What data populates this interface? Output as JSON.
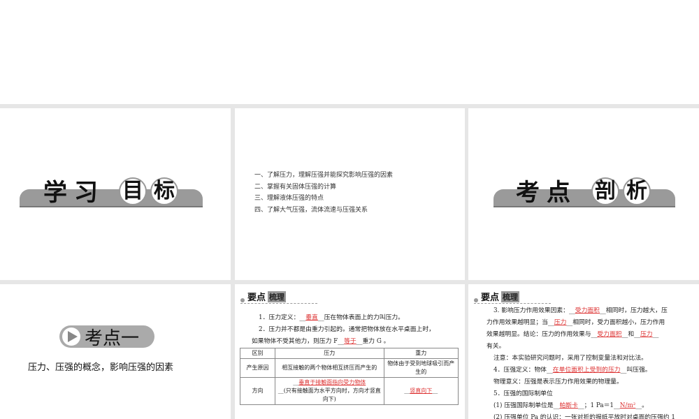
{
  "slide1": {
    "banner": [
      "学",
      "习",
      "目",
      "标"
    ]
  },
  "slide2": {
    "goals": [
      "一、了解压力，理解压强并能探究影响压强的因素",
      "二、掌握有关固体压强的计算",
      "三、理解液体压强的特点",
      "四、了解大气压强，流体流速与压强关系"
    ]
  },
  "slide3": {
    "banner": [
      "考",
      "点",
      "剖",
      "析"
    ]
  },
  "slide4": {
    "badge": "考点一",
    "subtitle": "压力、压强的概念，影响压强的因素"
  },
  "header": {
    "t1": "要点",
    "t2": "梳理"
  },
  "slide5": {
    "p1a": "1．压力定义：__",
    "p1b": "垂直",
    "p1c": "__压在物体表面上的力叫压力。",
    "p2a": "2．压力并不都是由重力引起的。通常把物体放在水平桌面上时，",
    "p2b": "如果物体不受其他力，则压力 F__",
    "p2c": "等于",
    "p2d": "__重力 G 。",
    "table": {
      "headers": [
        "区别",
        "压力",
        "重力"
      ],
      "row1": [
        "产生原因",
        "相互接触的两个物体相互挤压而产生的",
        "物体由于受到地球吸引而产生的"
      ],
      "row2_label": "方向",
      "row2_p_red": "垂直于接触面指向受力物体",
      "row2_p_rest": "__(只有接触面为水平方向时，方向才竖直向下)",
      "row2_g": "竖直向下"
    }
  },
  "slide6": {
    "l1a": "3. 影响压力作用效果因素：__",
    "l1b": "受力面积",
    "l1c": "__相同时，压力越大，压",
    "l2a": "力作用效果越明显；当__",
    "l2b": "压力",
    "l2c": "__相同时，受力面积越小，压力作用",
    "l3a": "效果越明显。结论：压力的作用效果与__",
    "l3b": "受力面积",
    "l3c": "__和__",
    "l3d": "压力",
    "l3e": "__",
    "l4": "有关。",
    "l5": "注意：本实验研究问题时，采用了控制变量法和对比法。",
    "l6a": "4．压强定义：物体__",
    "l6b": "在单位面积上受到的压力",
    "l6c": "__叫压强。",
    "l7": "物理意义：压强是表示压力作用效果的物理量。",
    "l8": "5．压强的国际制单位",
    "l9a": "(1) 压强国际制单位是__",
    "l9b": "帕斯卡",
    "l9c": "__；1 Pa＝1__",
    "l9d": "N/m²",
    "l9e": "__。",
    "l10": "(2) 压强单位 Pa 的认识：一张对折的报纸平放时对桌面的压强约 1"
  }
}
